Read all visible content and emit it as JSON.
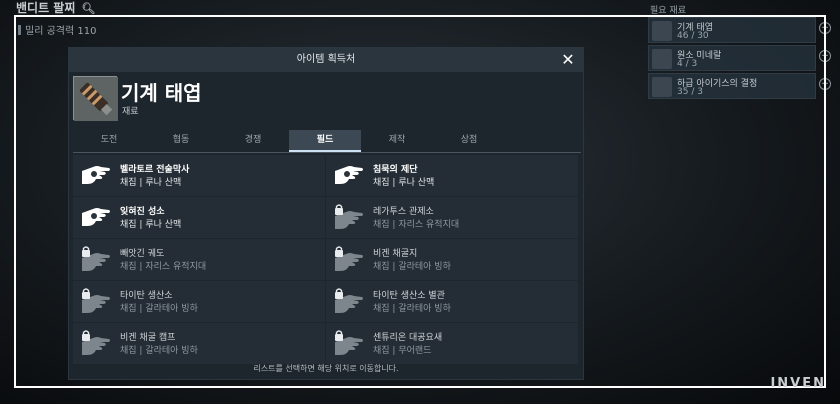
{
  "background": {
    "screen_title": "밴디트 팔찌",
    "stat_line": "밀리 공격력 110",
    "materials_title": "필요 재료",
    "materials": [
      {
        "name": "기계 태엽",
        "qty": "46 / 30"
      },
      {
        "name": "원소 미네랄",
        "qty": "4 / 3"
      },
      {
        "name": "하급 아이기스의 결정",
        "qty": "35 / 3"
      }
    ]
  },
  "modal": {
    "title": "아이템 획득처",
    "item_name": "기계 태엽",
    "item_type": "재료",
    "tabs": [
      {
        "label": "도전",
        "active": false
      },
      {
        "label": "협동",
        "active": false
      },
      {
        "label": "경쟁",
        "active": false
      },
      {
        "label": "필드",
        "active": true
      },
      {
        "label": "제작",
        "active": false
      },
      {
        "label": "상점",
        "active": false
      }
    ],
    "entries": [
      {
        "name": "벨라토르 전술막사",
        "location": "채집 | 루나 산맥",
        "locked": false
      },
      {
        "name": "침묵의 제단",
        "location": "채집 | 루나 산맥",
        "locked": false
      },
      {
        "name": "잊혀진 성소",
        "location": "채집 | 루나 산맥",
        "locked": false
      },
      {
        "name": "레가투스 관제소",
        "location": "채집 | 자리스 유적지대",
        "locked": true
      },
      {
        "name": "빼앗긴 궤도",
        "location": "채집 | 자리스 유적지대",
        "locked": true
      },
      {
        "name": "비겐 채굴지",
        "location": "채집 | 갈라테아 빙하",
        "locked": true
      },
      {
        "name": "타이탄 생산소",
        "location": "채집 | 갈라테아 빙하",
        "locked": true
      },
      {
        "name": "타이탄 생산소 별관",
        "location": "채집 | 갈라테아 빙하",
        "locked": true
      },
      {
        "name": "비겐 채굴 캠프",
        "location": "채집 | 갈라테아 빙하",
        "locked": true
      },
      {
        "name": "센튜리온 대공요새",
        "location": "채집 | 무어랜드",
        "locked": true
      }
    ],
    "footer": "리스트를 선택하면 해당 위치로 이동합니다."
  },
  "watermark": "INVEN",
  "colors": {
    "accent_tab": "#3c4853",
    "panel": "#1e262d",
    "entry": "#242d35"
  }
}
